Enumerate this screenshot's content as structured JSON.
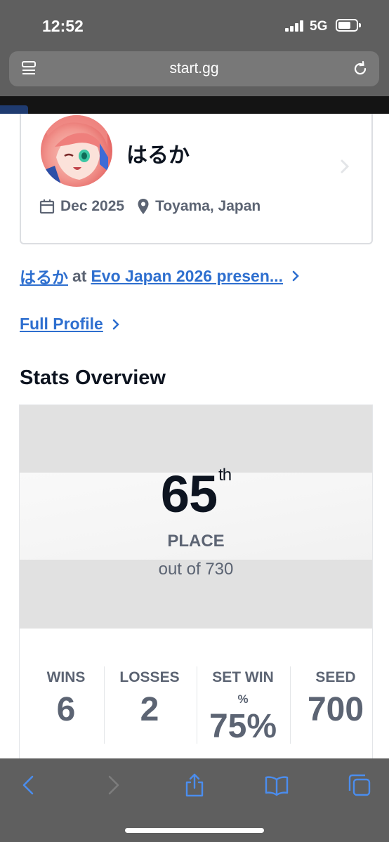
{
  "status_bar": {
    "time": "12:52",
    "network": "5G"
  },
  "browser": {
    "url": "start.gg"
  },
  "profile": {
    "name": "はるか",
    "date": "Dec 2025",
    "location": "Toyama, Japan"
  },
  "event_link": {
    "player": "はるか",
    "at": "at",
    "event": "Evo Japan 2026 presen..."
  },
  "full_profile": {
    "label": "Full Profile"
  },
  "stats_overview": {
    "title": "Stats Overview",
    "placement": {
      "number": "65",
      "suffix": "th",
      "label": "PLACE",
      "out_of": "out of 730"
    },
    "stats": [
      {
        "label": "WINS",
        "value": "6"
      },
      {
        "label": "LOSSES",
        "value": "2"
      },
      {
        "label_line1": "SET WIN",
        "label_line2": "%",
        "value": "75%"
      },
      {
        "label": "SEED",
        "value": "700"
      }
    ]
  },
  "colors": {
    "link": "#2e6fcf",
    "text_muted": "#5c6473",
    "chrome": "#5f5f5f",
    "ios_blue": "#4b8dee"
  }
}
